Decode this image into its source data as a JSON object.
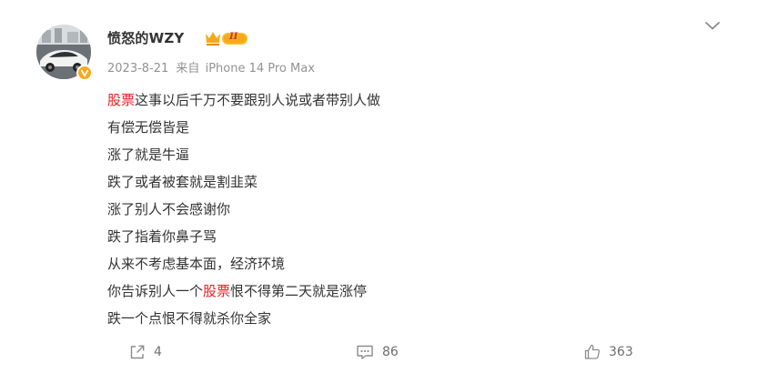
{
  "post": {
    "author": "愤怒的WZY",
    "vip_label": "II",
    "date": "2023-8-21",
    "source_prefix": "来自",
    "source_device": "iPhone 14 Pro Max",
    "lines": [
      [
        {
          "t": "股票",
          "hl": true
        },
        {
          "t": "这事以后千万不要跟别人说或者带别人做",
          "hl": false
        }
      ],
      [
        {
          "t": "有偿无偿皆是",
          "hl": false
        }
      ],
      [
        {
          "t": "涨了就是牛逼",
          "hl": false
        }
      ],
      [
        {
          "t": "跌了或者被套就是割韭菜",
          "hl": false
        }
      ],
      [
        {
          "t": "涨了别人不会感谢你",
          "hl": false
        }
      ],
      [
        {
          "t": "跌了指着你鼻子骂",
          "hl": false
        }
      ],
      [
        {
          "t": "从来不考虑基本面，经济环境",
          "hl": false
        }
      ],
      [
        {
          "t": "你告诉别人一个",
          "hl": false
        },
        {
          "t": "股票",
          "hl": true
        },
        {
          "t": "恨不得第二天就是涨停",
          "hl": false
        }
      ],
      [
        {
          "t": "跌一个点恨不得就杀你全家",
          "hl": false
        }
      ]
    ]
  },
  "actions": {
    "share_count": "4",
    "comment_count": "86",
    "like_count": "363"
  },
  "icons": {
    "share": "share-icon",
    "comment": "comment-icon",
    "like": "thumbs-up-icon",
    "menu": "chevron-down-icon",
    "verified": "verified-badge-icon",
    "vip": "vip-crown-icon"
  },
  "colors": {
    "highlight": "#eb1d24",
    "text": "#333333",
    "meta": "#939393",
    "vip_gold": "#f7a91c"
  }
}
